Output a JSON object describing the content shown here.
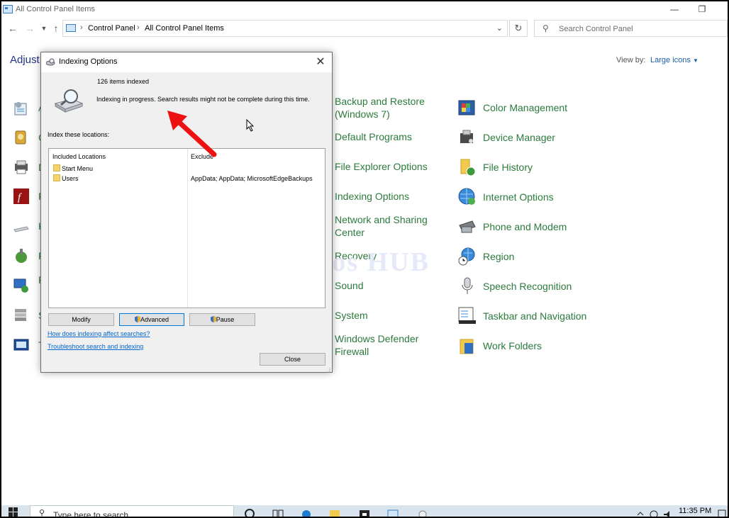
{
  "window": {
    "title": "All Control Panel Items"
  },
  "address": {
    "crumbs": [
      "Control Panel",
      "All Control Panel Items"
    ]
  },
  "search": {
    "placeholder": "Search Control Panel"
  },
  "heading": "Adjust y",
  "view_by": {
    "label": "View by:",
    "value": "Large icons"
  },
  "left_letters": [
    "A",
    "C",
    "D",
    "F",
    "K",
    "F",
    "F",
    "G",
    "S",
    "T"
  ],
  "items_mid": [
    {
      "label": "Backup and Restore",
      "label2": "(Windows 7)"
    },
    {
      "label": "Default Programs"
    },
    {
      "label": "File Explorer Options"
    },
    {
      "label": "Indexing Options"
    },
    {
      "label": "Network and Sharing",
      "label2": "Center"
    },
    {
      "label": "Recovery"
    },
    {
      "label": "Sound"
    },
    {
      "label": "System"
    },
    {
      "label": "Windows Defender",
      "label2": "Firewall"
    }
  ],
  "items_right": [
    {
      "label": "Color Management"
    },
    {
      "label": "Device Manager"
    },
    {
      "label": "File History"
    },
    {
      "label": "Internet Options"
    },
    {
      "label": "Phone and Modem"
    },
    {
      "label": "Region"
    },
    {
      "label": "Speech Recognition"
    },
    {
      "label": "Taskbar and Navigation"
    },
    {
      "label": "Work Folders"
    }
  ],
  "watermark": "IT Pros HUB",
  "dialog": {
    "title": "Indexing Options",
    "items_indexed": "126 items indexed",
    "status": "Indexing in progress. Search results might not be complete during this time.",
    "index_label": "Index these locations:",
    "columns": [
      "Included Locations",
      "Exclude"
    ],
    "rows": [
      {
        "location": "Start Menu",
        "exclude": ""
      },
      {
        "location": "Users",
        "exclude": "AppData; AppData; MicrosoftEdgeBackups"
      }
    ],
    "buttons": {
      "modify": "Modify",
      "advanced": "Advanced",
      "pause": "Pause",
      "close": "Close"
    },
    "links": [
      "How does indexing affect searches?",
      "Troubleshoot search and indexing"
    ]
  },
  "taskbar": {
    "search_placeholder": "Type here to search",
    "time": "11:35 PM"
  },
  "colors": {
    "link_green": "#2c7a3c",
    "heading_blue": "#1e3287",
    "arrow_red": "#ee1111"
  }
}
